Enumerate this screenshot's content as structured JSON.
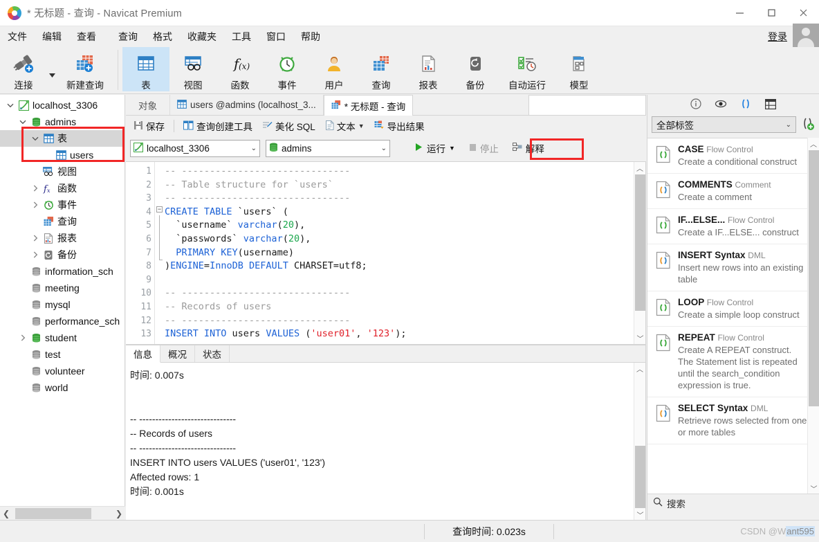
{
  "window": {
    "title": "* 无标题 - 查询 - Navicat Premium",
    "minimize": "—",
    "maximize": "□",
    "close": "✕"
  },
  "menubar": {
    "items": [
      "文件",
      "编辑",
      "查看",
      "查询",
      "格式",
      "收藏夹",
      "工具",
      "窗口",
      "帮助"
    ],
    "login_label": "登录"
  },
  "ribbon": {
    "buttons": [
      {
        "label": "连接",
        "icon": "connection-icon",
        "selected": false
      },
      {
        "label": "新建查询",
        "icon": "new-query-icon",
        "selected": false
      },
      {
        "label": "表",
        "icon": "table-icon",
        "selected": true
      },
      {
        "label": "视图",
        "icon": "view-icon",
        "selected": false
      },
      {
        "label": "函数",
        "icon": "function-icon",
        "selected": false
      },
      {
        "label": "事件",
        "icon": "event-icon",
        "selected": false
      },
      {
        "label": "用户",
        "icon": "user-icon",
        "selected": false
      },
      {
        "label": "查询",
        "icon": "query-icon",
        "selected": false
      },
      {
        "label": "报表",
        "icon": "report-icon",
        "selected": false
      },
      {
        "label": "备份",
        "icon": "backup-icon",
        "selected": false
      },
      {
        "label": "自动运行",
        "icon": "automation-icon",
        "selected": false
      },
      {
        "label": "模型",
        "icon": "model-icon",
        "selected": false
      }
    ]
  },
  "sidebar": {
    "nodes": [
      {
        "label": "localhost_3306",
        "indent": 0,
        "twisty": "expanded",
        "icon": "mysql-connection-icon",
        "selected": false
      },
      {
        "label": "admins",
        "indent": 1,
        "twisty": "expanded",
        "icon": "database-green-icon",
        "selected": false
      },
      {
        "label": "表",
        "indent": 2,
        "twisty": "expanded",
        "icon": "table-icon",
        "selected": true
      },
      {
        "label": "users",
        "indent": 3,
        "twisty": "none",
        "icon": "table-icon",
        "selected": false
      },
      {
        "label": "视图",
        "indent": 2,
        "twisty": "none",
        "icon": "view-icon",
        "selected": false
      },
      {
        "label": "函数",
        "indent": 2,
        "twisty": "collapsed",
        "icon": "function-icon",
        "selected": false
      },
      {
        "label": "事件",
        "indent": 2,
        "twisty": "collapsed",
        "icon": "event-icon",
        "selected": false
      },
      {
        "label": "查询",
        "indent": 2,
        "twisty": "none",
        "icon": "query-icon",
        "selected": false
      },
      {
        "label": "报表",
        "indent": 2,
        "twisty": "collapsed",
        "icon": "report-icon",
        "selected": false
      },
      {
        "label": "备份",
        "indent": 2,
        "twisty": "collapsed",
        "icon": "backup-icon",
        "selected": false
      },
      {
        "label": "information_sch",
        "indent": 1,
        "twisty": "none",
        "icon": "database-gray-icon",
        "selected": false
      },
      {
        "label": "meeting",
        "indent": 1,
        "twisty": "none",
        "icon": "database-gray-icon",
        "selected": false
      },
      {
        "label": "mysql",
        "indent": 1,
        "twisty": "none",
        "icon": "database-gray-icon",
        "selected": false
      },
      {
        "label": "performance_sch",
        "indent": 1,
        "twisty": "none",
        "icon": "database-gray-icon",
        "selected": false
      },
      {
        "label": "student",
        "indent": 1,
        "twisty": "collapsed",
        "icon": "database-green-icon",
        "selected": false
      },
      {
        "label": "test",
        "indent": 1,
        "twisty": "none",
        "icon": "database-gray-icon",
        "selected": false
      },
      {
        "label": "volunteer",
        "indent": 1,
        "twisty": "none",
        "icon": "database-gray-icon",
        "selected": false
      },
      {
        "label": "world",
        "indent": 1,
        "twisty": "none",
        "icon": "database-gray-icon",
        "selected": false
      }
    ]
  },
  "editor": {
    "tabs": [
      {
        "label": "对象",
        "icon": null,
        "active": false
      },
      {
        "label": "users @admins (localhost_3...",
        "icon": "table-icon",
        "active": false
      },
      {
        "label": "* 无标题 - 查询",
        "icon": "query-icon",
        "active": true
      }
    ],
    "toolbar": [
      {
        "label": "保存",
        "icon": "save-icon"
      },
      {
        "label": "查询创建工具",
        "icon": "query-builder-icon"
      },
      {
        "label": "美化 SQL",
        "icon": "beautify-icon"
      },
      {
        "label": "文本",
        "icon": "text-icon",
        "caret": true
      },
      {
        "label": "导出结果",
        "icon": "export-icon"
      }
    ],
    "connection_value": "localhost_3306",
    "database_value": "admins",
    "run_label": "运行",
    "stop_label": "停止",
    "explain_label": "解释",
    "code_lines": [
      {
        "n": 1,
        "tokens": [
          {
            "t": "-- ------------------------------",
            "c": "cmt"
          }
        ]
      },
      {
        "n": 2,
        "tokens": [
          {
            "t": "-- Table structure for `users`",
            "c": "cmt"
          }
        ]
      },
      {
        "n": 3,
        "tokens": [
          {
            "t": "-- ------------------------------",
            "c": "cmt"
          }
        ]
      },
      {
        "n": 4,
        "tokens": [
          {
            "t": "CREATE TABLE",
            "c": "kw"
          },
          {
            "t": " `users` (",
            "c": "txt"
          }
        ]
      },
      {
        "n": 5,
        "tokens": [
          {
            "t": "  `username` ",
            "c": "txt"
          },
          {
            "t": "varchar",
            "c": "kw"
          },
          {
            "t": "(",
            "c": "txt"
          },
          {
            "t": "20",
            "c": "num"
          },
          {
            "t": "),",
            "c": "txt"
          }
        ]
      },
      {
        "n": 6,
        "tokens": [
          {
            "t": "  `passwords` ",
            "c": "txt"
          },
          {
            "t": "varchar",
            "c": "kw"
          },
          {
            "t": "(",
            "c": "txt"
          },
          {
            "t": "20",
            "c": "num"
          },
          {
            "t": "),",
            "c": "txt"
          }
        ]
      },
      {
        "n": 7,
        "tokens": [
          {
            "t": "  ",
            "c": "txt"
          },
          {
            "t": "PRIMARY KEY",
            "c": "kw"
          },
          {
            "t": "(username)",
            "c": "txt"
          }
        ]
      },
      {
        "n": 8,
        "tokens": [
          {
            "t": ")",
            "c": "txt"
          },
          {
            "t": "ENGINE",
            "c": "kw"
          },
          {
            "t": "=",
            "c": "txt"
          },
          {
            "t": "InnoDB DEFAULT",
            "c": "kw"
          },
          {
            "t": " CHARSET=utf8;",
            "c": "txt"
          }
        ]
      },
      {
        "n": 9,
        "tokens": [
          {
            "t": "",
            "c": "txt"
          }
        ]
      },
      {
        "n": 10,
        "tokens": [
          {
            "t": "-- ------------------------------",
            "c": "cmt"
          }
        ]
      },
      {
        "n": 11,
        "tokens": [
          {
            "t": "-- Records of users",
            "c": "cmt"
          }
        ]
      },
      {
        "n": 12,
        "tokens": [
          {
            "t": "-- ------------------------------",
            "c": "cmt"
          }
        ]
      },
      {
        "n": 13,
        "tokens": [
          {
            "t": "INSERT INTO",
            "c": "kw"
          },
          {
            "t": " users ",
            "c": "txt"
          },
          {
            "t": "VALUES",
            "c": "kw"
          },
          {
            "t": " (",
            "c": "txt"
          },
          {
            "t": "'user01'",
            "c": "str"
          },
          {
            "t": ", ",
            "c": "txt"
          },
          {
            "t": "'123'",
            "c": "str"
          },
          {
            "t": ");",
            "c": "txt"
          }
        ]
      }
    ]
  },
  "results": {
    "tabs": [
      {
        "label": "信息",
        "active": true
      },
      {
        "label": "概况",
        "active": false
      },
      {
        "label": "状态",
        "active": false
      }
    ],
    "lines": [
      "时间: 0.007s",
      "",
      "",
      "-- ------------------------------",
      "-- Records of users",
      "-- ------------------------------",
      "INSERT INTO users VALUES ('user01', '123')",
      "Affected rows: 1",
      "时间: 0.001s"
    ]
  },
  "right_panel": {
    "header_icons": [
      "info-icon",
      "eye-icon",
      "snippet-icon",
      "grid-icon"
    ],
    "filter_value": "全部标签",
    "add_snippet_icon": "add-snippet-icon",
    "snippets": [
      {
        "title": "CASE",
        "category": "Flow Control",
        "desc": "Create a conditional construct",
        "icon_color": "green"
      },
      {
        "title": "COMMENTS",
        "category": "Comment",
        "desc": "Create a comment",
        "icon_color": "orange"
      },
      {
        "title": "IF...ELSE...",
        "category": "Flow Control",
        "desc": "Create a IF...ELSE... construct",
        "icon_color": "green"
      },
      {
        "title": "INSERT Syntax",
        "category": "DML",
        "desc": "Insert new rows into an existing table",
        "icon_color": "orange"
      },
      {
        "title": "LOOP",
        "category": "Flow Control",
        "desc": "Create a simple loop construct",
        "icon_color": "green"
      },
      {
        "title": "REPEAT",
        "category": "Flow Control",
        "desc": "Create A REPEAT construct. The Statement list is repeated until the search_condition expression is true.",
        "icon_color": "green"
      },
      {
        "title": "SELECT Syntax",
        "category": "DML",
        "desc": "Retrieve rows selected from one or more tables",
        "icon_color": "orange"
      }
    ],
    "search_placeholder": "搜索"
  },
  "statusbar": {
    "query_time": "查询时间: 0.023s",
    "watermark_prefix": "CSDN @W",
    "watermark_selected": "ant595"
  },
  "colors": {
    "accent_blue": "#1d62d6",
    "select_blue": "#cce4f7",
    "highlight_red": "#f12626",
    "green": "#1aa64b",
    "string_red": "#e0202a"
  }
}
